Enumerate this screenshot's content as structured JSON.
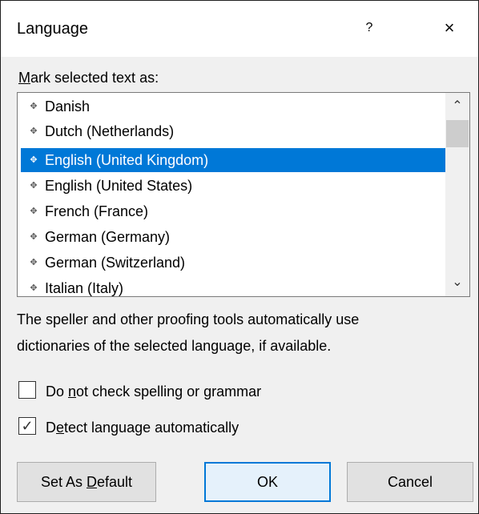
{
  "window": {
    "title": "Language",
    "help_glyph": "?",
    "close_glyph": "×"
  },
  "section_label_prefix": "M",
  "section_label_rest": "ark selected text as:",
  "languages": [
    "Danish",
    "Dutch (Netherlands)",
    "English (United Kingdom)",
    "English (United States)",
    "French (France)",
    "German (Germany)",
    "German (Switzerland)",
    "Italian (Italy)"
  ],
  "selected_language": "English (United Kingdom)",
  "info_line_1": "The speller and other proofing tools automatically use",
  "info_line_2": "dictionaries of the selected language, if available.",
  "checkbox_no_check": {
    "pre": "Do ",
    "accel": "n",
    "post": "ot check spelling or grammar",
    "checked": false
  },
  "checkbox_detect": {
    "pre": "D",
    "accel": "e",
    "post": "tect language automatically",
    "checked": true
  },
  "buttons": {
    "set_default": {
      "pre": "Set As ",
      "accel": "D",
      "post": "efault"
    },
    "ok": "OK",
    "cancel": "Cancel"
  },
  "colors": {
    "selection": "#0078d7",
    "dialog_bg": "#f0f0f0"
  }
}
